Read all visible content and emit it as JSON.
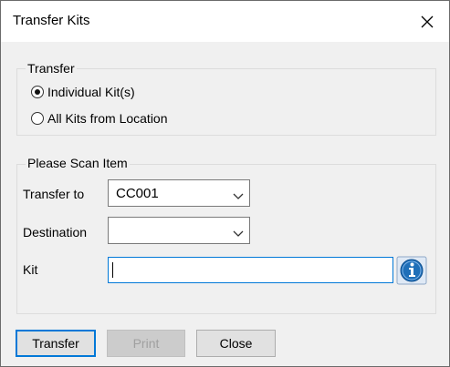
{
  "window": {
    "title": "Transfer Kits",
    "close_icon": "close-icon"
  },
  "transfer_group": {
    "legend": "Transfer",
    "options": [
      {
        "label": "Individual Kit(s)",
        "checked": true
      },
      {
        "label": "All Kits from Location",
        "checked": false
      }
    ]
  },
  "scan_group": {
    "legend": "Please Scan Item",
    "transfer_to": {
      "label": "Transfer to",
      "value": "CC001"
    },
    "destination": {
      "label": "Destination",
      "value": ""
    },
    "kit": {
      "label": "Kit",
      "value": "",
      "info_icon": "info-icon"
    }
  },
  "buttons": {
    "transfer": "Transfer",
    "print": "Print",
    "close": "Close"
  },
  "colors": {
    "accent": "#0078d7",
    "info_icon": "#1f6fb8"
  }
}
